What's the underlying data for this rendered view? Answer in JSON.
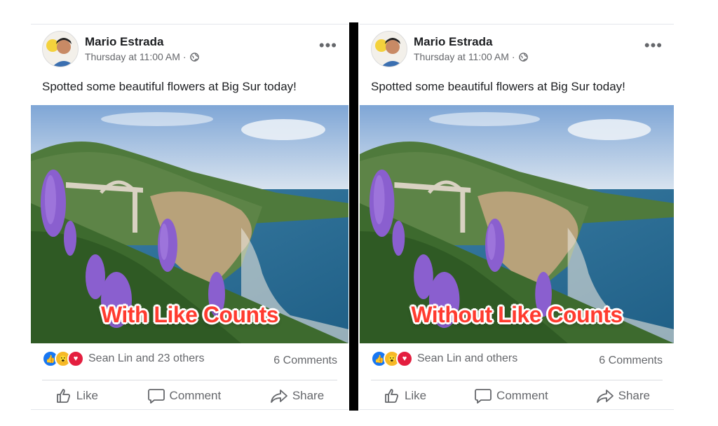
{
  "posts": [
    {
      "author": "Mario Estrada",
      "timestamp": "Thursday at 11:00 AM",
      "meta_dot": "·",
      "privacy_icon": "globe-icon",
      "caption": "Spotted some beautiful flowers at Big Sur today!",
      "overlay_label": "With Like Counts",
      "reactions_text": "Sean Lin and 23 others",
      "comments": "6 Comments",
      "actions": {
        "like": "Like",
        "comment": "Comment",
        "share": "Share"
      }
    },
    {
      "author": "Mario Estrada",
      "timestamp": "Thursday at 11:00 AM",
      "meta_dot": "·",
      "privacy_icon": "globe-icon",
      "caption": "Spotted some beautiful flowers at Big Sur today!",
      "overlay_label": "Without Like Counts",
      "reactions_text": "Sean Lin and others",
      "comments": "6 Comments",
      "actions": {
        "like": "Like",
        "comment": "Comment",
        "share": "Share"
      }
    }
  ],
  "more_icon": "•••",
  "colors": {
    "accent": "#1877f2",
    "overlay_red": "#ff3b2f",
    "text": "#1c1e21",
    "muted": "#65676b"
  },
  "icons": [
    "like-reaction-icon",
    "wow-reaction-icon",
    "love-reaction-icon",
    "thumbs-up-icon",
    "comment-icon",
    "share-icon",
    "more-options-icon"
  ]
}
